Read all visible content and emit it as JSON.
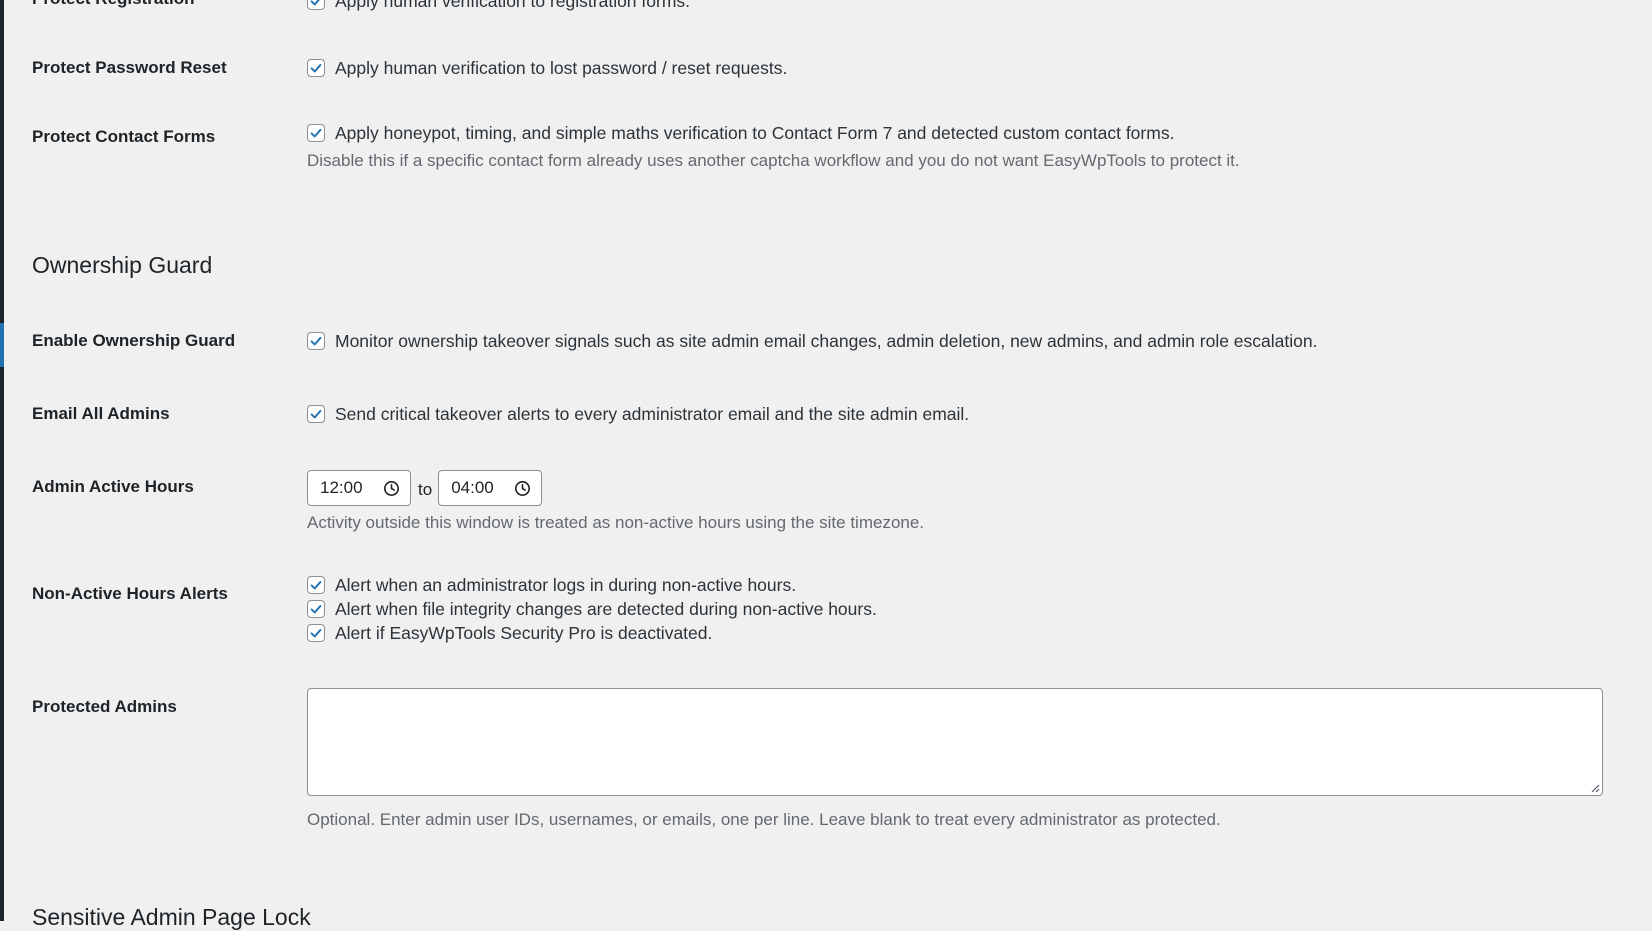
{
  "fields": {
    "protect_registration": {
      "label": "Protect Registration",
      "checkbox_label": "Apply human verification to registration forms.",
      "checked": true
    },
    "protect_password_reset": {
      "label": "Protect Password Reset",
      "checkbox_label": "Apply human verification to lost password / reset requests.",
      "checked": true
    },
    "protect_contact_forms": {
      "label": "Protect Contact Forms",
      "checkbox_label": "Apply honeypot, timing, and simple maths verification to Contact Form 7 and detected custom contact forms.",
      "description": "Disable this if a specific contact form already uses another captcha workflow and you do not want EasyWpTools to protect it.",
      "checked": true
    }
  },
  "ownership_guard": {
    "title": "Ownership Guard",
    "enable": {
      "label": "Enable Ownership Guard",
      "checkbox_label": "Monitor ownership takeover signals such as site admin email changes, admin deletion, new admins, and admin role escalation.",
      "checked": true
    },
    "email_all_admins": {
      "label": "Email All Admins",
      "checkbox_label": "Send critical takeover alerts to every administrator email and the site admin email.",
      "checked": true
    },
    "active_hours": {
      "label": "Admin Active Hours",
      "start": "12:00",
      "separator": "to",
      "end": "04:00",
      "description": "Activity outside this window is treated as non-active hours using the site timezone."
    },
    "non_active_alerts": {
      "label": "Non-Active Hours Alerts",
      "options": [
        {
          "label": "Alert when an administrator logs in during non-active hours.",
          "checked": true
        },
        {
          "label": "Alert when file integrity changes are detected during non-active hours.",
          "checked": true
        },
        {
          "label": "Alert if EasyWpTools Security Pro is deactivated.",
          "checked": true
        }
      ]
    },
    "protected_admins": {
      "label": "Protected Admins",
      "value": "",
      "description": "Optional. Enter admin user IDs, usernames, or emails, one per line. Leave blank to treat every administrator as protected."
    }
  },
  "next_section": {
    "title": "Sensitive Admin Page Lock"
  },
  "colors": {
    "background": "#f0f0f1",
    "accent": "#2271b1",
    "text": "#1d2327",
    "muted": "#646970"
  },
  "icons": {
    "checkbox": "checkmark-icon",
    "time": "clock-icon"
  }
}
